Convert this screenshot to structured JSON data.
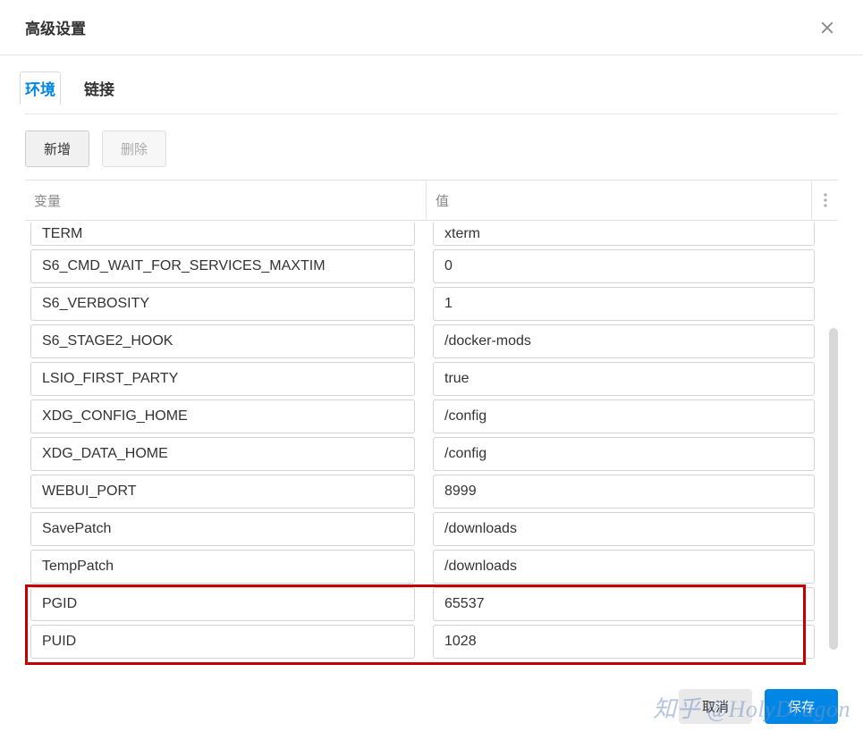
{
  "header": {
    "title": "高级设置"
  },
  "tabs": [
    {
      "label": "环境",
      "active": true
    },
    {
      "label": "链接",
      "active": false
    }
  ],
  "toolbar": {
    "add_label": "新增",
    "delete_label": "删除"
  },
  "table": {
    "col_var": "变量",
    "col_val": "值"
  },
  "rows": [
    {
      "var": "TERM",
      "val": "xterm",
      "cutoff": true
    },
    {
      "var": "S6_CMD_WAIT_FOR_SERVICES_MAXTIM",
      "val": "0"
    },
    {
      "var": "S6_VERBOSITY",
      "val": "1"
    },
    {
      "var": "S6_STAGE2_HOOK",
      "val": "/docker-mods"
    },
    {
      "var": "LSIO_FIRST_PARTY",
      "val": "true"
    },
    {
      "var": "XDG_CONFIG_HOME",
      "val": "/config"
    },
    {
      "var": "XDG_DATA_HOME",
      "val": "/config"
    },
    {
      "var": "WEBUI_PORT",
      "val": "8999"
    },
    {
      "var": "SavePatch",
      "val": "/downloads"
    },
    {
      "var": "TempPatch",
      "val": "/downloads"
    },
    {
      "var": "PGID",
      "val": "65537"
    },
    {
      "var": "PUID",
      "val": "1028"
    }
  ],
  "footer": {
    "cancel_label": "取消",
    "save_label": "保存"
  },
  "watermark": "知乎 @HolyDragon"
}
